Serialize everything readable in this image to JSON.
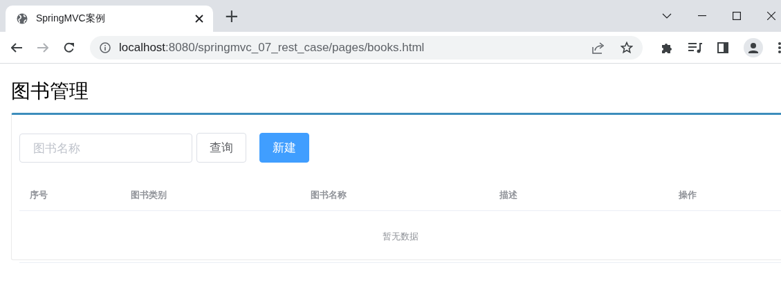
{
  "browser": {
    "tab": {
      "title": "SpringMVC案例",
      "selected": true
    },
    "new_tab": "+",
    "url_host": "localhost",
    "url_path": ":8080/springmvc_07_rest_case/pages/books.html"
  },
  "page": {
    "heading": "图书管理",
    "search": {
      "placeholder": "图书名称"
    },
    "buttons": [
      {
        "label": "查询",
        "kind": "default"
      },
      {
        "label": "新建",
        "kind": "primary"
      }
    ],
    "table": {
      "columns": [
        "序号",
        "图书类别",
        "图书名称",
        "描述",
        "操作"
      ],
      "empty_text": "暂无数据"
    }
  }
}
